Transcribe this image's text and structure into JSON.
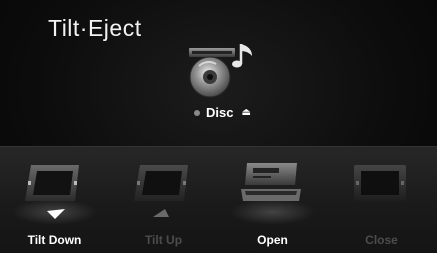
{
  "header": {
    "title": "Tilt·Eject"
  },
  "disc": {
    "label": "Disc",
    "eject_symbol": "⏏"
  },
  "controls": [
    {
      "label": "Tilt Down",
      "state": "enabled",
      "icon": "tilt-down-icon"
    },
    {
      "label": "Tilt Up",
      "state": "disabled",
      "icon": "tilt-up-icon"
    },
    {
      "label": "Open",
      "state": "enabled",
      "icon": "open-panel-icon"
    },
    {
      "label": "Close",
      "state": "disabled",
      "icon": "close-panel-icon"
    }
  ],
  "colors": {
    "background": "#0d0d0d",
    "control_bar": "#1f1f1f",
    "active_text": "#ffffff",
    "disabled_text": "#4c4c4c"
  }
}
